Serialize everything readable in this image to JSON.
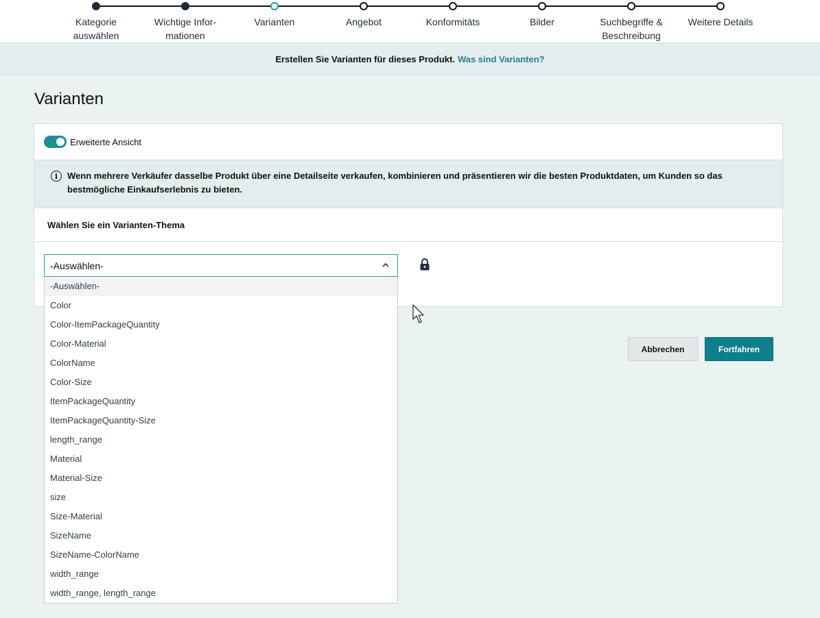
{
  "stepper": {
    "steps": [
      {
        "label": "Kategorie\nauswählen",
        "state": "done"
      },
      {
        "label": "Wichtige Infor-\nmationen",
        "state": "done"
      },
      {
        "label": "Varianten",
        "state": "active"
      },
      {
        "label": "Angebot",
        "state": "todo"
      },
      {
        "label": "Konformitäts",
        "state": "todo"
      },
      {
        "label": "Bilder",
        "state": "todo"
      },
      {
        "label": "Suchbegriffe &\nBeschreibung",
        "state": "todo"
      },
      {
        "label": "Weitere Details",
        "state": "todo"
      }
    ]
  },
  "banner": {
    "text": "Erstellen Sie Varianten für dieses Produkt.",
    "link": "Was sind Varianten?"
  },
  "page": {
    "title": "Varianten"
  },
  "card": {
    "toggle_label": "Erweiterte Ansicht",
    "toggle_on": true,
    "info_icon": "info-icon",
    "info_text": "Wenn mehrere Verkäufer dasselbe Produkt über eine Detailseite verkaufen, kombinieren und präsentieren wir die besten Produktdaten, um Kunden so das bestmögliche Einkaufserlebnis zu bieten.",
    "section_heading": "Wählen Sie ein Varianten-Thema"
  },
  "select": {
    "value": "-Auswählen-",
    "options": [
      "-Auswählen-",
      "Color",
      "Color-ItemPackageQuantity",
      "Color-Material",
      "ColorName",
      "Color-Size",
      "ItemPackageQuantity",
      "ItemPackageQuantity-Size",
      "length_range",
      "Material",
      "Material-Size",
      "size",
      "Size-Material",
      "SizeName",
      "SizeName-ColorName",
      "width_range",
      "width_range, length_range"
    ]
  },
  "actions": {
    "cancel": "Abbrechen",
    "continue": "Fortfahren"
  },
  "colors": {
    "accent": "#2a9aa6",
    "primary_button": "#0e7f8b",
    "toggle": "#1c8f9a"
  }
}
